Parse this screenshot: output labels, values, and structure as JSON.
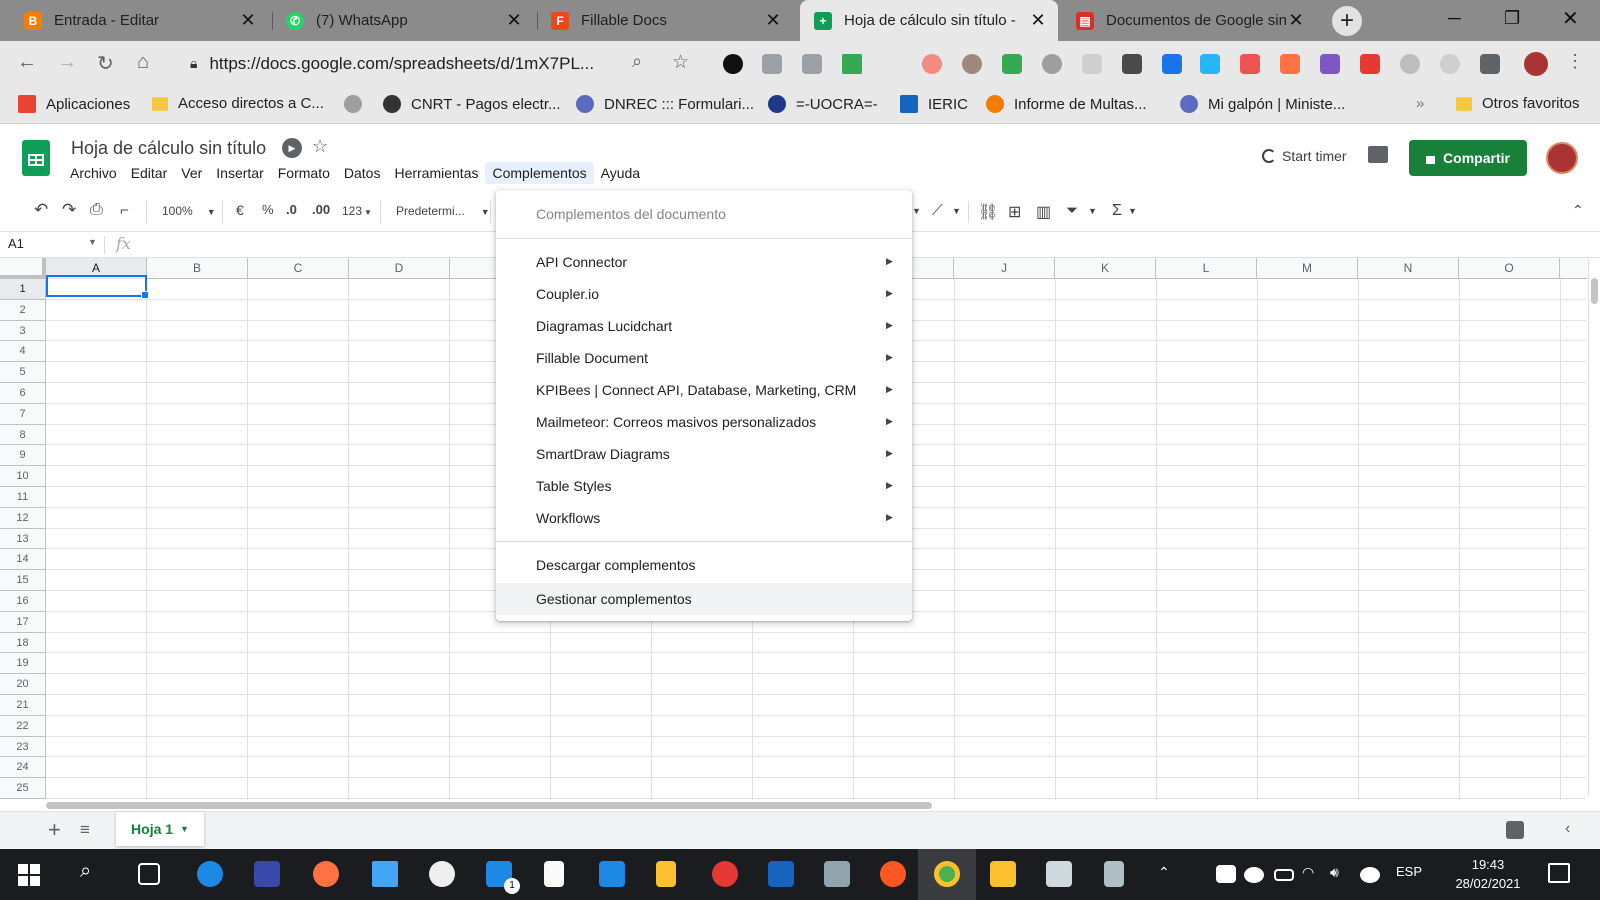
{
  "browser": {
    "tabs": [
      {
        "title": "Entrada - Editar",
        "icon": "blogger-icon",
        "color": "#f57d00"
      },
      {
        "title": "(7) WhatsApp",
        "icon": "whatsapp-icon",
        "color": "#25d366"
      },
      {
        "title": "Fillable Docs",
        "icon": "fillable-docs-icon",
        "color": "#e64a19"
      },
      {
        "title": "Hoja de cálculo sin título - ",
        "icon": "sheets-icon",
        "color": "#0f9d58"
      },
      {
        "title": "Documentos de Google sin",
        "icon": "docs-icon",
        "color": "#d93025"
      }
    ],
    "url": "https://docs.google.com/spreadsheets/d/1mX7PL...",
    "bookmarks": [
      "Aplicaciones",
      "Acceso directos a C...",
      "CNRT - Pagos electr...",
      "DNREC ::: Formulari...",
      "=-UOCRA=-",
      "IERIC",
      "Informe de Multas...",
      "Mi galpón | Ministe...",
      "Otros favoritos"
    ],
    "bookmarks_more": "»"
  },
  "sheets": {
    "title": "Hoja de cálculo sin título",
    "menu": [
      "Archivo",
      "Editar",
      "Ver",
      "Insertar",
      "Formato",
      "Datos",
      "Herramientas",
      "Complementos",
      "Ayuda"
    ],
    "start_timer": "Start timer",
    "share_label": "Compartir",
    "toolbar": {
      "zoom": "100%",
      "currency": "€",
      "percent": "%",
      "dec_decrease": ".0",
      "dec_increase": ".00",
      "more_formats": "123",
      "font": "Predetermi..."
    },
    "namebox": "A1",
    "fx": "fx",
    "columns_left": [
      "A",
      "B",
      "C",
      "D"
    ],
    "columns_right": [
      "J",
      "K",
      "L",
      "M",
      "N",
      "O"
    ],
    "rows": [
      "1",
      "2",
      "3",
      "4",
      "5",
      "6",
      "7",
      "8",
      "9",
      "10",
      "11",
      "12",
      "13",
      "14",
      "15",
      "16",
      "17",
      "18",
      "19",
      "20",
      "21",
      "22",
      "23",
      "24",
      "25"
    ],
    "sheet_tab": "Hoja 1"
  },
  "addons_menu": {
    "header": "Complementos del documento",
    "items": [
      "API Connector",
      "Coupler.io",
      "Diagramas Lucidchart",
      "Fillable Document",
      "KPIBees | Connect API, Database, Marketing, CRM",
      "Mailmeteor: Correos masivos personalizados",
      "SmartDraw Diagrams",
      "Table Styles",
      "Workflows"
    ],
    "get_addons": "Descargar complementos",
    "manage_addons": "Gestionar complementos"
  },
  "taskbar": {
    "language": "ESP",
    "time": "19:43",
    "date": "28/02/2021",
    "mail_badge": "1"
  },
  "colors": {
    "sheets_green": "#0f9d58",
    "share_green": "#188038",
    "selection_blue": "#1a73e8"
  }
}
